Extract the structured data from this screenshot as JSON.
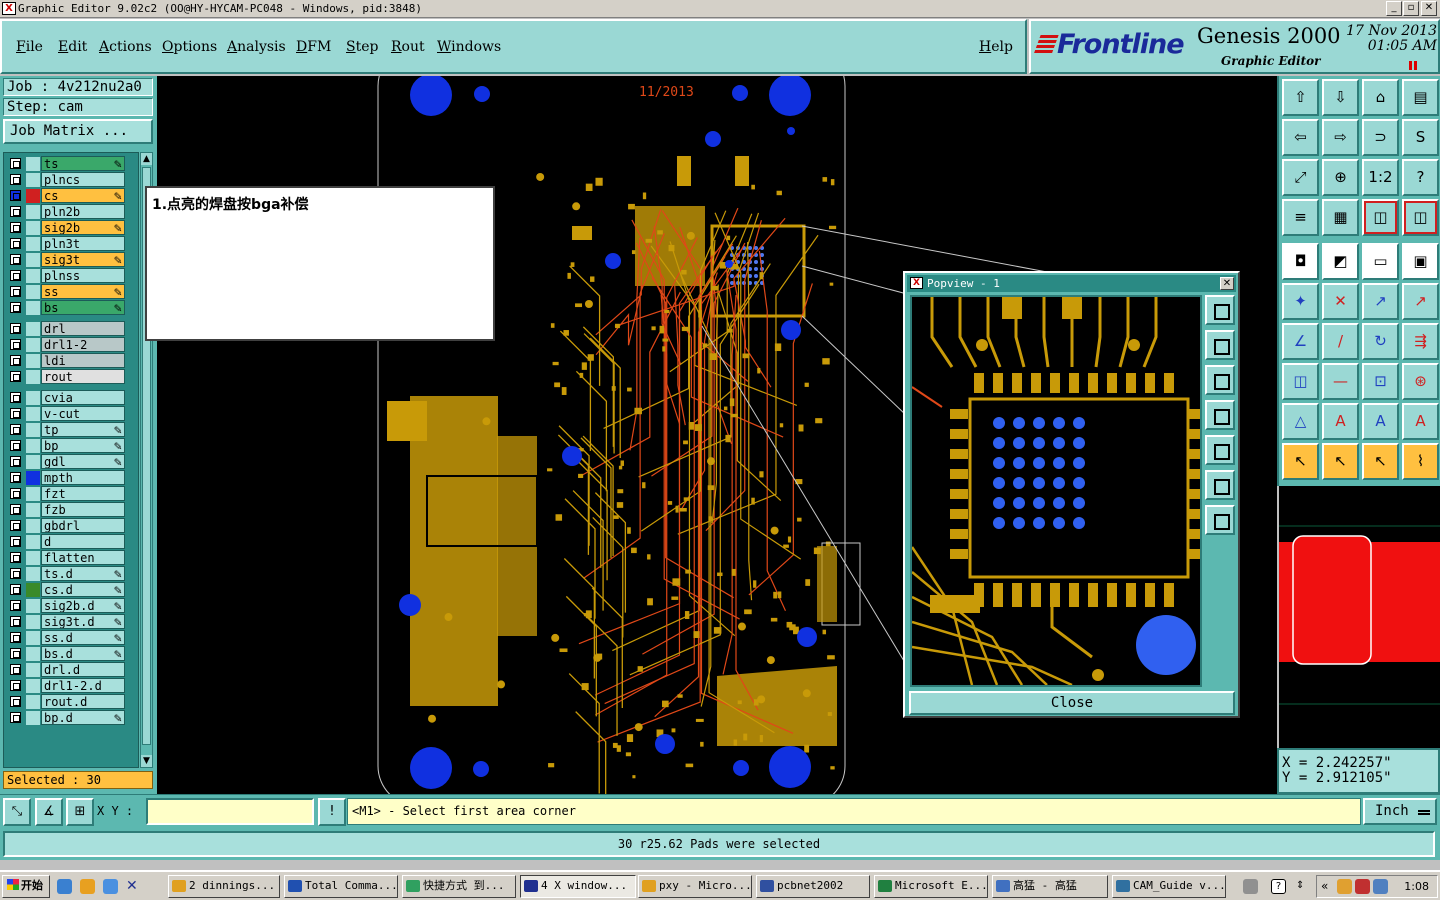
{
  "window": {
    "title": "Graphic Editor 9.02c2 (OO@HY-HYCAM-PC048 - Windows, pid:3848)",
    "controls": [
      "_",
      "▫",
      "✕"
    ]
  },
  "menu": [
    "File",
    "Edit",
    "Actions",
    "Options",
    "Analysis",
    "DFM",
    "Step",
    "Rout",
    "Windows"
  ],
  "help_label": "Help",
  "brand": {
    "logo": "Frontline",
    "product": "Genesis 2000",
    "subtitle": "Graphic Editor",
    "date": "17 Nov 2013",
    "time": "01:05 AM",
    "accent": "#d21010"
  },
  "job": {
    "job_line": "Job : 4v212nu2a0",
    "step_line": "Step: cam",
    "matrix_label": "Job Matrix ..."
  },
  "layers": [
    {
      "name": "ts",
      "color": "#3aa86a",
      "affected": true
    },
    {
      "name": "plncs",
      "color": "#a8e0dc",
      "affected": false
    },
    {
      "name": "cs",
      "color": "#ffc040",
      "affected": true,
      "work": true
    },
    {
      "name": "pln2b",
      "color": "#a8e0dc",
      "affected": false
    },
    {
      "name": "sig2b",
      "color": "#ffc040",
      "affected": true
    },
    {
      "name": "pln3t",
      "color": "#a8e0dc",
      "affected": false
    },
    {
      "name": "sig3t",
      "color": "#ffc040",
      "affected": true
    },
    {
      "name": "plnss",
      "color": "#a8e0dc",
      "affected": false
    },
    {
      "name": "ss",
      "color": "#ffc040",
      "affected": true
    },
    {
      "name": "bs",
      "color": "#3aa86a",
      "affected": true
    },
    {
      "name": "drl",
      "color": "#b8c8c8",
      "affected": false
    },
    {
      "name": "drl1-2",
      "color": "#b8c8c8",
      "affected": false
    },
    {
      "name": "ldi",
      "color": "#b8c8c8",
      "affected": false
    },
    {
      "name": "rout",
      "color": "#e0e0e0",
      "affected": false
    },
    {
      "name": "cvia",
      "color": "#a8e0dc",
      "affected": false
    },
    {
      "name": "v-cut",
      "color": "#a8e0dc",
      "affected": false
    },
    {
      "name": "tp",
      "color": "#a8e0dc",
      "affected": true
    },
    {
      "name": "bp",
      "color": "#a8e0dc",
      "affected": true
    },
    {
      "name": "gdl",
      "color": "#a8e0dc",
      "affected": true
    },
    {
      "name": "mpth",
      "color": "#a8e0dc",
      "affected": false,
      "swatch": "#1030e0"
    },
    {
      "name": "fzt",
      "color": "#a8e0dc",
      "affected": false
    },
    {
      "name": "fzb",
      "color": "#a8e0dc",
      "affected": false
    },
    {
      "name": "gbdrl",
      "color": "#a8e0dc",
      "affected": false
    },
    {
      "name": "d",
      "color": "#a8e0dc",
      "affected": false
    },
    {
      "name": "flatten",
      "color": "#a8e0dc",
      "affected": false
    },
    {
      "name": "ts.d",
      "color": "#a8e0dc",
      "affected": true
    },
    {
      "name": "cs.d",
      "color": "#a8e0dc",
      "affected": true,
      "swatch": "#3a8a2a"
    },
    {
      "name": "sig2b.d",
      "color": "#a8e0dc",
      "affected": true
    },
    {
      "name": "sig3t.d",
      "color": "#a8e0dc",
      "affected": true
    },
    {
      "name": "ss.d",
      "color": "#a8e0dc",
      "affected": true
    },
    {
      "name": "bs.d",
      "color": "#a8e0dc",
      "affected": true
    },
    {
      "name": "drl.d",
      "color": "#a8e0dc",
      "affected": false
    },
    {
      "name": "drl1-2.d",
      "color": "#a8e0dc",
      "affected": false
    },
    {
      "name": "rout.d",
      "color": "#a8e0dc",
      "affected": false
    },
    {
      "name": "bp.d",
      "color": "#a8e0dc",
      "affected": true
    }
  ],
  "selected_label": "Selected : 30",
  "board": {
    "date_mark": "11/2013",
    "trace_color": "#e04818",
    "copper_color": "#c89a08",
    "hole_color": "#1030e0",
    "outline_color": "#c8c8c8"
  },
  "note": "1.点亮的焊盘按bga补偿",
  "popview": {
    "title": "Popview - 1",
    "close_label": "Close",
    "highlight_color": "#3060f0"
  },
  "toolbox": {
    "rows": [
      [
        "⇧",
        "⇩",
        "⌂",
        "▤"
      ],
      [
        "⇦",
        "⇨",
        "⊃",
        "S"
      ],
      [
        "⤢",
        "⊕",
        "1:2",
        "?"
      ],
      [
        "≡",
        "▦",
        "◫",
        "◫"
      ],
      [
        "◘",
        "◩",
        "▭",
        "▣"
      ],
      [
        "✦",
        "✕",
        "↗",
        "↗"
      ],
      [
        "∠",
        "/",
        "↻",
        "⇶"
      ],
      [
        "◫",
        "—",
        "⊡",
        "⊛"
      ],
      [
        "△",
        "A",
        "A",
        "A"
      ],
      [
        "↖",
        "↖",
        "↖",
        "⌇"
      ]
    ]
  },
  "coords": {
    "x_line": "X = 2.242257\"",
    "y_line": "Y = 2.912105\""
  },
  "cmdbar": {
    "xy_label": "X Y :",
    "xy_value": "",
    "prompt": "<M1> - Select first area corner",
    "unit": "Inch",
    "bang": "!"
  },
  "status": "30 r25.62 Pads were selected",
  "taskbar": {
    "start": "开始",
    "tasks": [
      "2 dinnings...",
      "Total Comma...",
      "快捷方式 到...",
      "4 X window...",
      "pxy - Micro...",
      "pcbnet2002",
      "Microsoft E...",
      "高猛 - 高猛",
      "CAM_Guide v..."
    ],
    "clock": "1:08"
  }
}
